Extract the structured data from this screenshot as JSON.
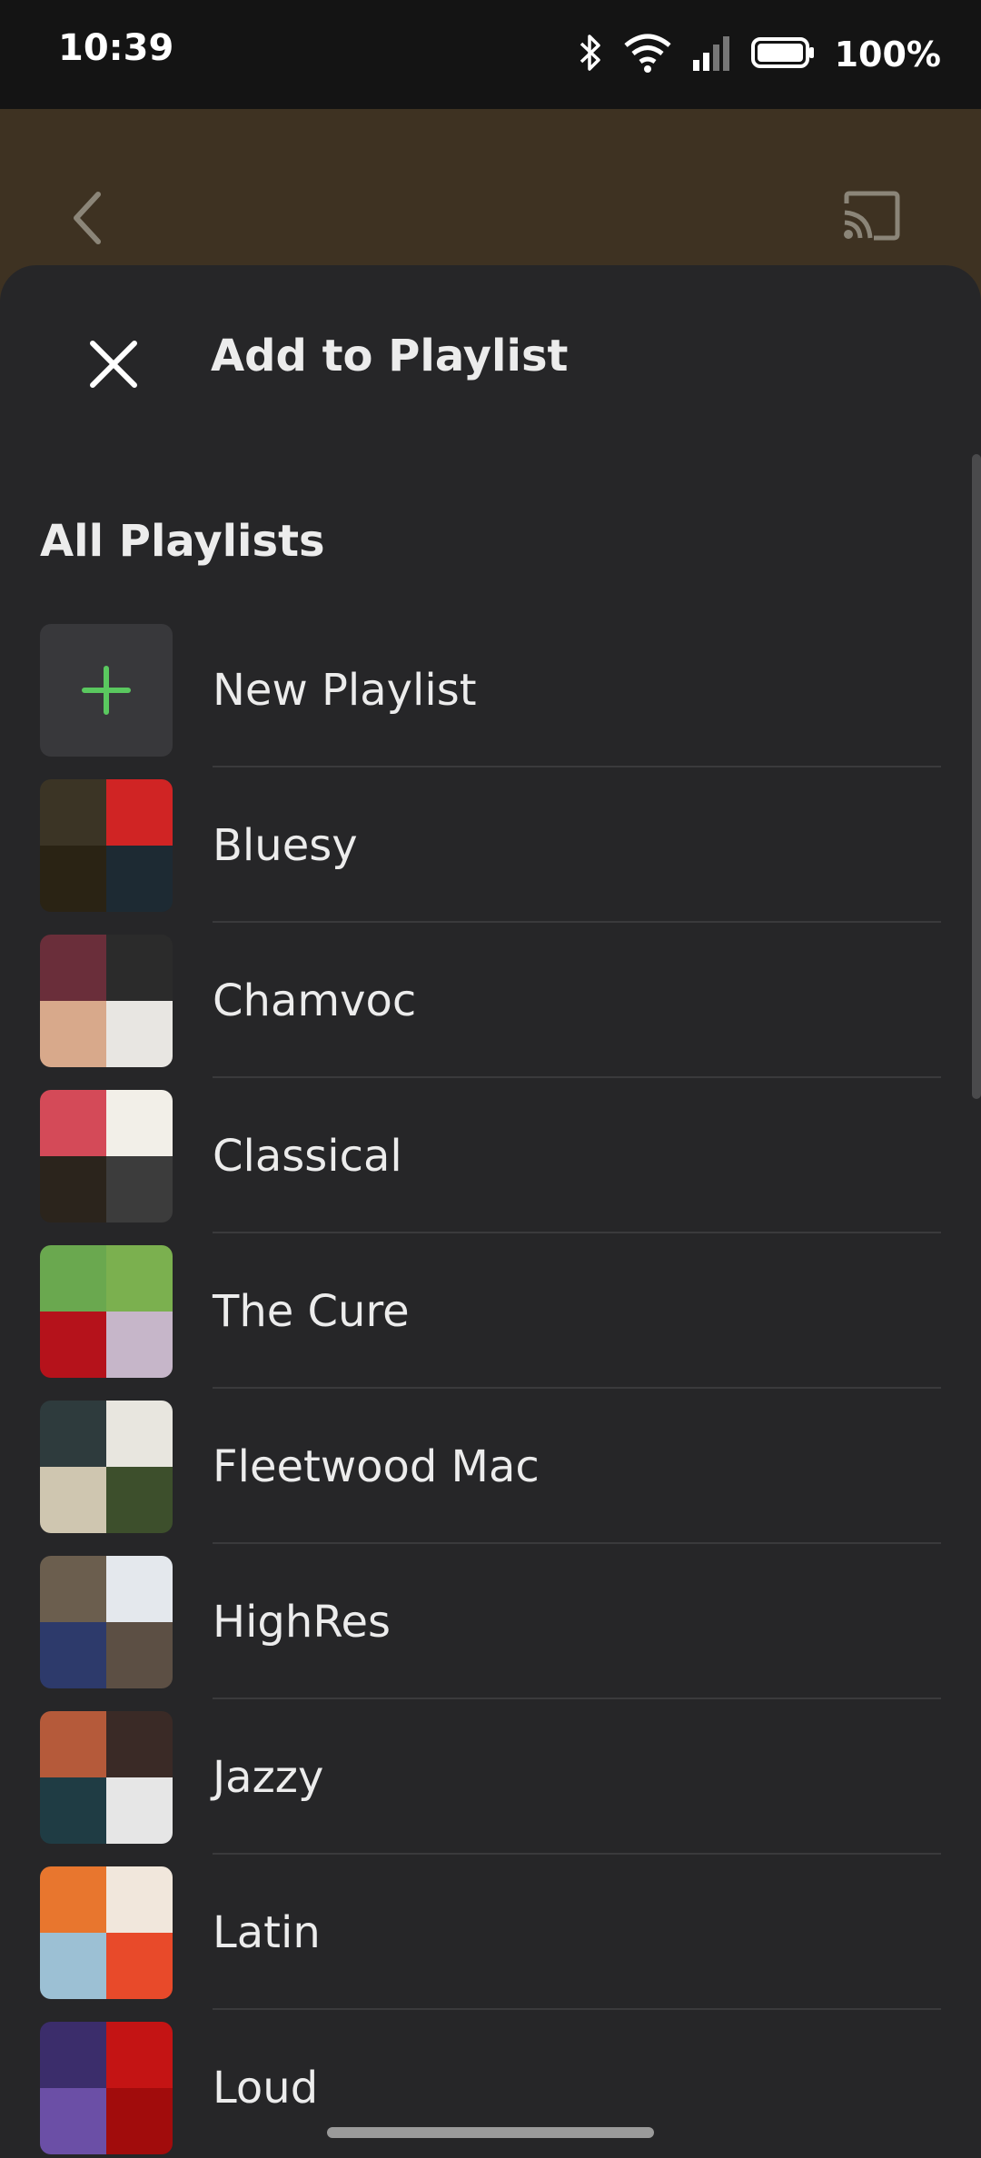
{
  "status_bar": {
    "time": "10:39",
    "battery_percent": "100%",
    "icons": [
      "bluetooth-icon",
      "wifi-icon",
      "cell-signal-icon",
      "battery-icon"
    ]
  },
  "backdrop": {
    "color": "#3e3222",
    "icons": [
      "back-chevron-icon",
      "cast-icon"
    ]
  },
  "sheet": {
    "title": "Add to Playlist",
    "section_title": "All Playlists",
    "new_playlist_label": "New Playlist",
    "accent_color": "#5ac85f",
    "playlists": [
      {
        "name": "Bluesy",
        "art_colors": [
          "#3b3425",
          "#d02424",
          "#2a2314",
          "#1d2a33"
        ]
      },
      {
        "name": "Chamvoc",
        "art_colors": [
          "#6a2e3a",
          "#2b2b2b",
          "#d8a98b",
          "#e8e6e2"
        ]
      },
      {
        "name": "Classical",
        "art_colors": [
          "#d44a58",
          "#f2efe8",
          "#2b241c",
          "#3c3c3c"
        ]
      },
      {
        "name": "The Cure",
        "art_colors": [
          "#6aa84f",
          "#7bb04f",
          "#b5121b",
          "#c6b6c9"
        ]
      },
      {
        "name": "Fleetwood Mac",
        "art_colors": [
          "#2e3b3d",
          "#e8e6df",
          "#cfc6b0",
          "#3d4f2c"
        ]
      },
      {
        "name": "HighRes",
        "art_colors": [
          "#6b5e4e",
          "#e4e8ed",
          "#2d3a6b",
          "#5c4f44"
        ]
      },
      {
        "name": "Jazzy",
        "art_colors": [
          "#b55a3a",
          "#3a2a26",
          "#1f3c44",
          "#e6e6e6"
        ]
      },
      {
        "name": "Latin",
        "art_colors": [
          "#e8762e",
          "#f1e7dc",
          "#9cc0d4",
          "#e84a2a"
        ]
      },
      {
        "name": "Loud",
        "art_colors": [
          "#3b2d6b",
          "#c41414",
          "#6b4fa6",
          "#a10c0c"
        ]
      }
    ]
  }
}
